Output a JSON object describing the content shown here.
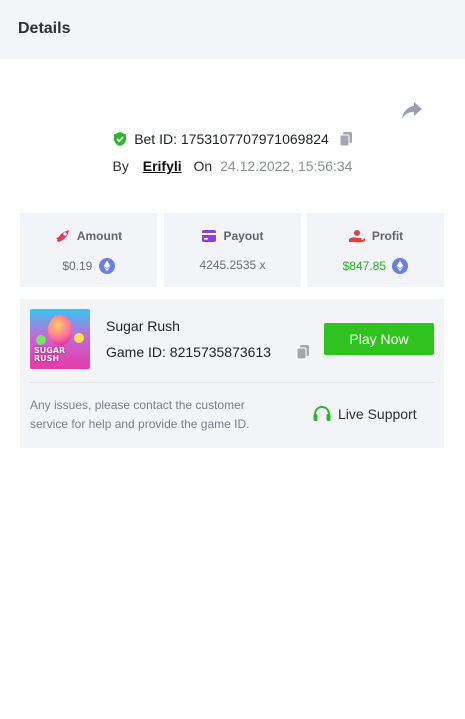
{
  "header": {
    "title": "Details"
  },
  "bet": {
    "id_text": "Bet ID: 1753107707971069824",
    "by_label": "By",
    "user": "Erifyli",
    "on_label": "On",
    "date": "24.12.2022, 15:56:34"
  },
  "stats": [
    {
      "label": "Amount",
      "value": "$0.19",
      "icon": "rocket-icon",
      "currency_icon": "ethereum-icon"
    },
    {
      "label": "Payout",
      "value": "4245.2535 x",
      "icon": "card-icon"
    },
    {
      "label": "Profit",
      "value": "$847.85",
      "icon": "hand-coin-icon",
      "currency_icon": "ethereum-icon"
    }
  ],
  "game": {
    "name": "Sugar Rush",
    "id_text": "Game ID: 8215735873613",
    "thumbnail_logo": "SUGAR RUSH",
    "play_label": "Play Now",
    "notice": "Any issues, please contact the customer service for help and provide the game ID.",
    "support_label": "Live Support"
  },
  "colors": {
    "accent_green": "#30c21f",
    "profit_green": "#25b21f",
    "amount_icon": "#e23a5c",
    "payout_icon": "#8b3fe0",
    "profit_icon": "#e2403a",
    "eth_blue": "#6a7fe0"
  }
}
